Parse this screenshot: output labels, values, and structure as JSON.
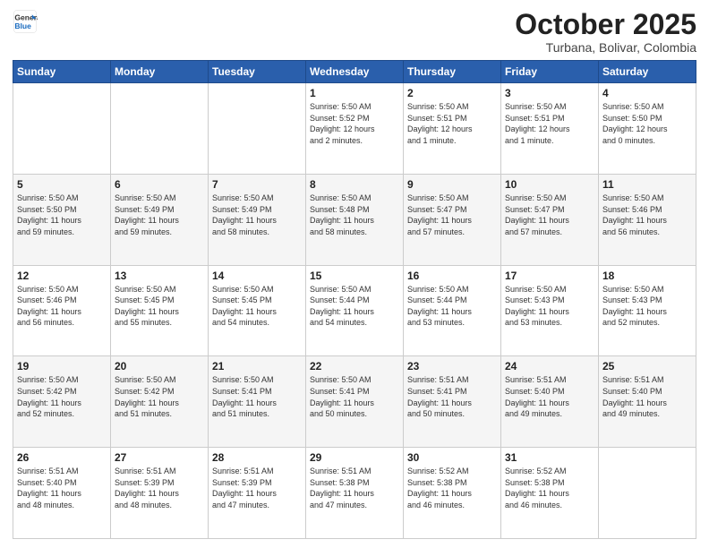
{
  "logo": {
    "general": "General",
    "blue": "Blue"
  },
  "header": {
    "month": "October 2025",
    "location": "Turbana, Bolivar, Colombia"
  },
  "weekdays": [
    "Sunday",
    "Monday",
    "Tuesday",
    "Wednesday",
    "Thursday",
    "Friday",
    "Saturday"
  ],
  "weeks": [
    [
      {
        "day": "",
        "info": ""
      },
      {
        "day": "",
        "info": ""
      },
      {
        "day": "",
        "info": ""
      },
      {
        "day": "1",
        "info": "Sunrise: 5:50 AM\nSunset: 5:52 PM\nDaylight: 12 hours\nand 2 minutes."
      },
      {
        "day": "2",
        "info": "Sunrise: 5:50 AM\nSunset: 5:51 PM\nDaylight: 12 hours\nand 1 minute."
      },
      {
        "day": "3",
        "info": "Sunrise: 5:50 AM\nSunset: 5:51 PM\nDaylight: 12 hours\nand 1 minute."
      },
      {
        "day": "4",
        "info": "Sunrise: 5:50 AM\nSunset: 5:50 PM\nDaylight: 12 hours\nand 0 minutes."
      }
    ],
    [
      {
        "day": "5",
        "info": "Sunrise: 5:50 AM\nSunset: 5:50 PM\nDaylight: 11 hours\nand 59 minutes."
      },
      {
        "day": "6",
        "info": "Sunrise: 5:50 AM\nSunset: 5:49 PM\nDaylight: 11 hours\nand 59 minutes."
      },
      {
        "day": "7",
        "info": "Sunrise: 5:50 AM\nSunset: 5:49 PM\nDaylight: 11 hours\nand 58 minutes."
      },
      {
        "day": "8",
        "info": "Sunrise: 5:50 AM\nSunset: 5:48 PM\nDaylight: 11 hours\nand 58 minutes."
      },
      {
        "day": "9",
        "info": "Sunrise: 5:50 AM\nSunset: 5:47 PM\nDaylight: 11 hours\nand 57 minutes."
      },
      {
        "day": "10",
        "info": "Sunrise: 5:50 AM\nSunset: 5:47 PM\nDaylight: 11 hours\nand 57 minutes."
      },
      {
        "day": "11",
        "info": "Sunrise: 5:50 AM\nSunset: 5:46 PM\nDaylight: 11 hours\nand 56 minutes."
      }
    ],
    [
      {
        "day": "12",
        "info": "Sunrise: 5:50 AM\nSunset: 5:46 PM\nDaylight: 11 hours\nand 56 minutes."
      },
      {
        "day": "13",
        "info": "Sunrise: 5:50 AM\nSunset: 5:45 PM\nDaylight: 11 hours\nand 55 minutes."
      },
      {
        "day": "14",
        "info": "Sunrise: 5:50 AM\nSunset: 5:45 PM\nDaylight: 11 hours\nand 54 minutes."
      },
      {
        "day": "15",
        "info": "Sunrise: 5:50 AM\nSunset: 5:44 PM\nDaylight: 11 hours\nand 54 minutes."
      },
      {
        "day": "16",
        "info": "Sunrise: 5:50 AM\nSunset: 5:44 PM\nDaylight: 11 hours\nand 53 minutes."
      },
      {
        "day": "17",
        "info": "Sunrise: 5:50 AM\nSunset: 5:43 PM\nDaylight: 11 hours\nand 53 minutes."
      },
      {
        "day": "18",
        "info": "Sunrise: 5:50 AM\nSunset: 5:43 PM\nDaylight: 11 hours\nand 52 minutes."
      }
    ],
    [
      {
        "day": "19",
        "info": "Sunrise: 5:50 AM\nSunset: 5:42 PM\nDaylight: 11 hours\nand 52 minutes."
      },
      {
        "day": "20",
        "info": "Sunrise: 5:50 AM\nSunset: 5:42 PM\nDaylight: 11 hours\nand 51 minutes."
      },
      {
        "day": "21",
        "info": "Sunrise: 5:50 AM\nSunset: 5:41 PM\nDaylight: 11 hours\nand 51 minutes."
      },
      {
        "day": "22",
        "info": "Sunrise: 5:50 AM\nSunset: 5:41 PM\nDaylight: 11 hours\nand 50 minutes."
      },
      {
        "day": "23",
        "info": "Sunrise: 5:51 AM\nSunset: 5:41 PM\nDaylight: 11 hours\nand 50 minutes."
      },
      {
        "day": "24",
        "info": "Sunrise: 5:51 AM\nSunset: 5:40 PM\nDaylight: 11 hours\nand 49 minutes."
      },
      {
        "day": "25",
        "info": "Sunrise: 5:51 AM\nSunset: 5:40 PM\nDaylight: 11 hours\nand 49 minutes."
      }
    ],
    [
      {
        "day": "26",
        "info": "Sunrise: 5:51 AM\nSunset: 5:40 PM\nDaylight: 11 hours\nand 48 minutes."
      },
      {
        "day": "27",
        "info": "Sunrise: 5:51 AM\nSunset: 5:39 PM\nDaylight: 11 hours\nand 48 minutes."
      },
      {
        "day": "28",
        "info": "Sunrise: 5:51 AM\nSunset: 5:39 PM\nDaylight: 11 hours\nand 47 minutes."
      },
      {
        "day": "29",
        "info": "Sunrise: 5:51 AM\nSunset: 5:38 PM\nDaylight: 11 hours\nand 47 minutes."
      },
      {
        "day": "30",
        "info": "Sunrise: 5:52 AM\nSunset: 5:38 PM\nDaylight: 11 hours\nand 46 minutes."
      },
      {
        "day": "31",
        "info": "Sunrise: 5:52 AM\nSunset: 5:38 PM\nDaylight: 11 hours\nand 46 minutes."
      },
      {
        "day": "",
        "info": ""
      }
    ]
  ]
}
